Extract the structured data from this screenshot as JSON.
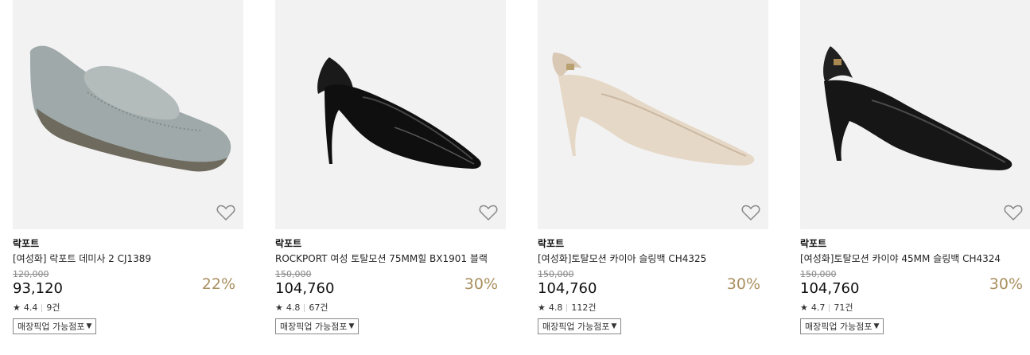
{
  "products": [
    {
      "brand": "락포트",
      "name": "[여성화] 락포트 데미사 2 CJ1389",
      "original_price": "120,000",
      "price": "93,120",
      "discount": "22%",
      "rating": "4.4",
      "review_count": "9건",
      "pickup_label": "매장픽업 가능점포",
      "image_icon": "gray-loafer"
    },
    {
      "brand": "락포트",
      "name": "ROCKPORT 여성 토탈모션 75MM힐 BX1901 블랙",
      "original_price": "150,000",
      "price": "104,760",
      "discount": "30%",
      "rating": "4.8",
      "review_count": "67건",
      "pickup_label": "매장픽업 가능점포",
      "image_icon": "black-slingback-heel"
    },
    {
      "brand": "락포트",
      "name": "[여성화]토탈모션 카이아 슬링백 CH4325",
      "original_price": "150,000",
      "price": "104,760",
      "discount": "30%",
      "rating": "4.8",
      "review_count": "112건",
      "pickup_label": "매장픽업 가능점포",
      "image_icon": "beige-slingback-heel"
    },
    {
      "brand": "락포트",
      "name": "[여성화]토탈모션 카이야 45MM 슬링백 CH4324",
      "original_price": "150,000",
      "price": "104,760",
      "discount": "30%",
      "rating": "4.7",
      "review_count": "71건",
      "pickup_label": "매장픽업 가능점포",
      "image_icon": "black-slingback-kitten-heel"
    }
  ],
  "colors": {
    "discount": "#a98f5f",
    "image_bg": "#f2f2f2"
  }
}
